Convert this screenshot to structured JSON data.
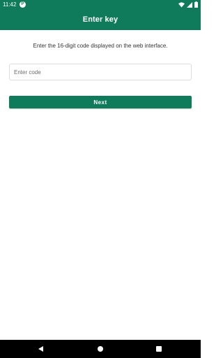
{
  "status_bar": {
    "time": "11:42",
    "app_icon_letter": "P",
    "icons": [
      "wifi-icon",
      "signal-icon",
      "battery-icon"
    ]
  },
  "app_bar": {
    "title": "Enter key"
  },
  "main": {
    "instruction": "Enter the 16-digit code displayed on the web interface.",
    "code_input": {
      "value": "",
      "placeholder": "Enter code"
    },
    "next_label": "Next"
  },
  "nav_bar": {
    "icons": [
      "back-icon",
      "home-icon",
      "recents-icon"
    ]
  },
  "colors": {
    "primary": "#0f7b5a",
    "nav_background": "#000000",
    "background": "#ffffff"
  }
}
